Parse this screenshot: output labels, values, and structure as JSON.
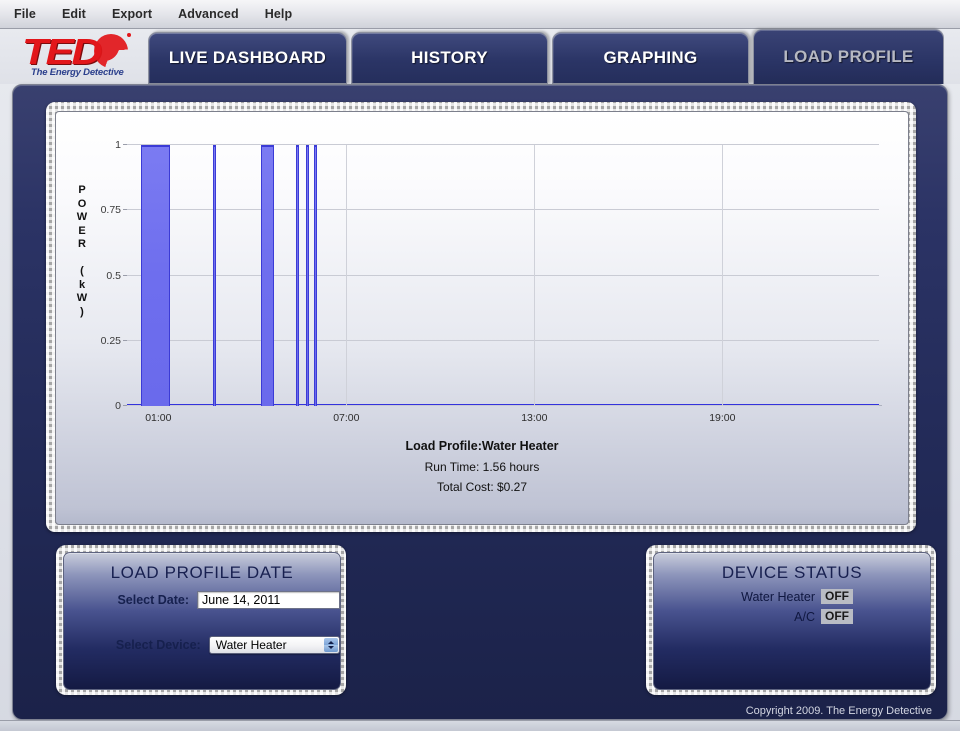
{
  "menubar": {
    "items": [
      {
        "label": "File"
      },
      {
        "label": "Edit"
      },
      {
        "label": "Export"
      },
      {
        "label": "Advanced"
      },
      {
        "label": "Help"
      }
    ]
  },
  "logo": {
    "wordmark": "TED",
    "tagline": "The Energy Detective"
  },
  "tabs": [
    {
      "label": "LIVE DASHBOARD",
      "active": false
    },
    {
      "label": "HISTORY",
      "active": false
    },
    {
      "label": "GRAPHING",
      "active": false
    },
    {
      "label": "LOAD PROFILE",
      "active": true
    }
  ],
  "chart_data": {
    "type": "bar",
    "title": "Load Profile:Water Heater",
    "xlabel": "",
    "ylabel": "POWER (kW)",
    "ylim": [
      0,
      1
    ],
    "xlim": [
      0,
      24
    ],
    "x_unit": "hours",
    "grid": true,
    "legend": "none",
    "y_ticks": [
      "0",
      "0.25",
      "0.5",
      "0.75",
      "1"
    ],
    "y_tick_values": [
      0,
      0.25,
      0.5,
      0.75,
      1
    ],
    "x_ticks": [
      "01:00",
      "07:00",
      "13:00",
      "19:00"
    ],
    "x_tick_values": [
      1,
      7,
      13,
      19
    ],
    "series": [
      {
        "name": "Water Heater",
        "color": "#6e6eee",
        "edge_color": "#3b3bd6",
        "intervals": [
          {
            "start": 0.45,
            "end": 1.37,
            "value": 1
          },
          {
            "start": 2.75,
            "end": 2.82,
            "value": 1
          },
          {
            "start": 4.28,
            "end": 4.7,
            "value": 1
          },
          {
            "start": 5.4,
            "end": 5.48,
            "value": 1
          },
          {
            "start": 5.72,
            "end": 5.8,
            "value": 1
          },
          {
            "start": 5.96,
            "end": 6.06,
            "value": 1
          }
        ]
      }
    ],
    "annotations": [
      {
        "text": "Run Time: 1.56 hours"
      },
      {
        "text": "Total Cost: $0.27"
      }
    ]
  },
  "chart_captions": {
    "title": "Load Profile:Water Heater",
    "run_time": "Run Time: 1.56 hours",
    "total_cost": "Total Cost: $0.27"
  },
  "load_profile_date": {
    "title": "LOAD PROFILE DATE",
    "date_label": "Select Date:",
    "date_value": "June 14, 2011",
    "date_placeholder": "June 14, 2011",
    "device_label": "Select Device:",
    "device_value": "Water Heater",
    "device_options": [
      "Water Heater",
      "A/C"
    ]
  },
  "device_status": {
    "title": "DEVICE STATUS",
    "rows": [
      {
        "name": "Water Heater",
        "state": "OFF"
      },
      {
        "name": "A/C",
        "state": "OFF"
      }
    ]
  },
  "footer": {
    "copyright": "Copyright 2009. The Energy Detective"
  },
  "colors": {
    "panel_blue": "#2b3365",
    "bar_fill": "#6e6eee",
    "bar_edge": "#3b3bd6",
    "logo_red": "#e2161a",
    "tagline_blue": "#2b3f8c"
  }
}
